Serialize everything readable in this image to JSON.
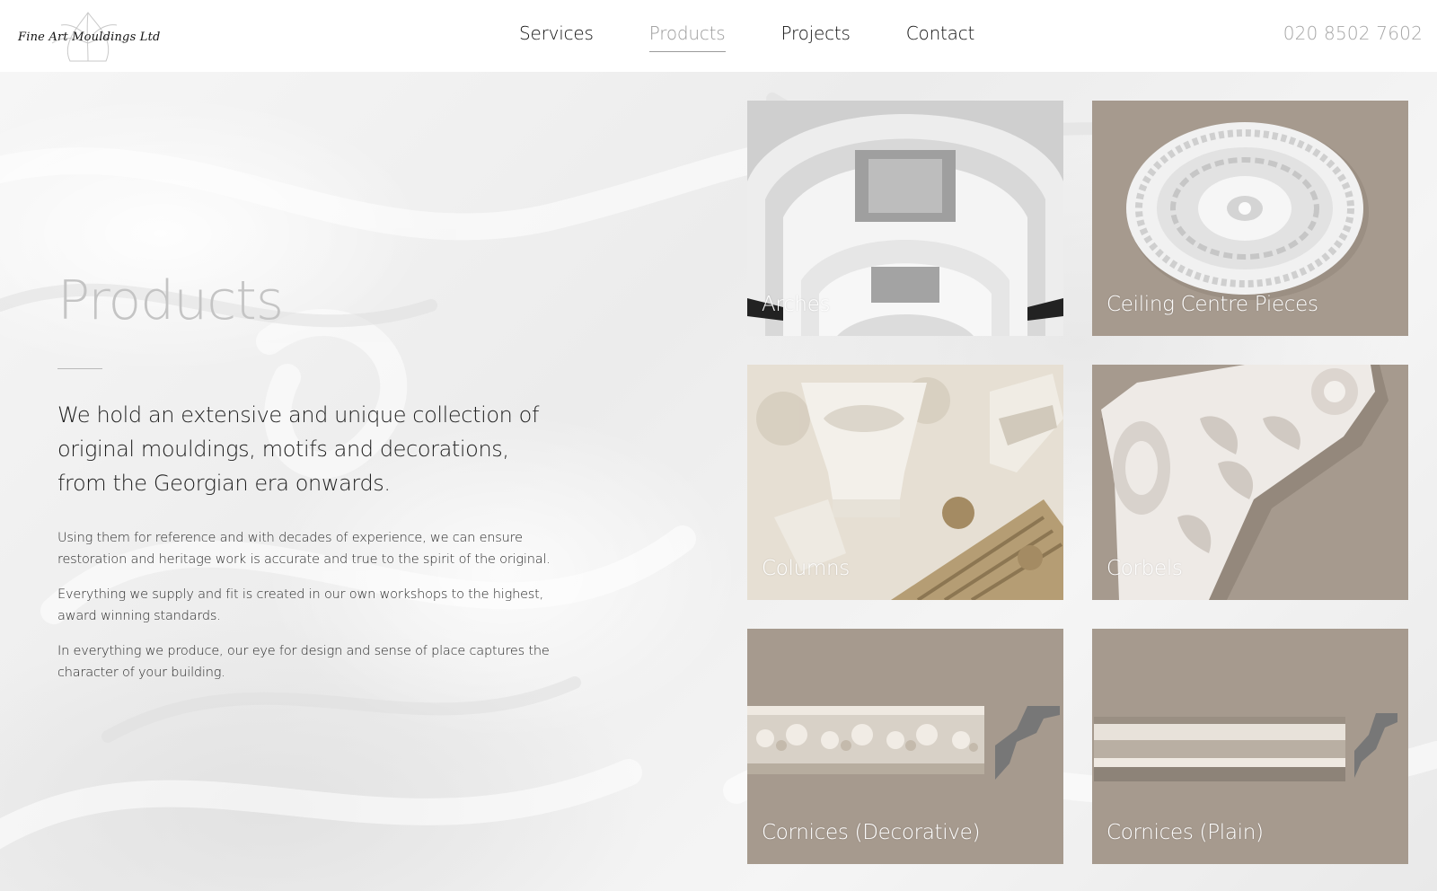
{
  "header": {
    "logo_text": "Fine Art Mouldings Ltd",
    "nav": [
      {
        "label": "Services"
      },
      {
        "label": "Products"
      },
      {
        "label": "Projects"
      },
      {
        "label": "Contact"
      }
    ],
    "active_nav": "Products",
    "phone": "020 8502 7602"
  },
  "intro": {
    "title": "Products",
    "lead": "We hold an extensive and unique collection of original mouldings, motifs and decorations, from the Georgian era onwards.",
    "paragraphs": [
      "Using them for reference and with decades of experience, we can ensure restoration and heritage work is accurate and true to the spirit of the original.",
      "Everything we supply and fit is created in our own workshops to the highest, award winning standards.",
      "In everything we produce, our eye for design and sense of place captures the character of your building."
    ]
  },
  "products": [
    {
      "label": "Arches"
    },
    {
      "label": "Ceiling Centre Pieces"
    },
    {
      "label": "Columns"
    },
    {
      "label": "Corbels"
    },
    {
      "label": "Cornices (Decorative)"
    },
    {
      "label": "Cornices (Plain)"
    }
  ],
  "colors": {
    "card_bg": "#a69a8e",
    "nav_active": "#9a9a9a",
    "title": "#c4c4c4",
    "phone": "#a5a5a5"
  }
}
